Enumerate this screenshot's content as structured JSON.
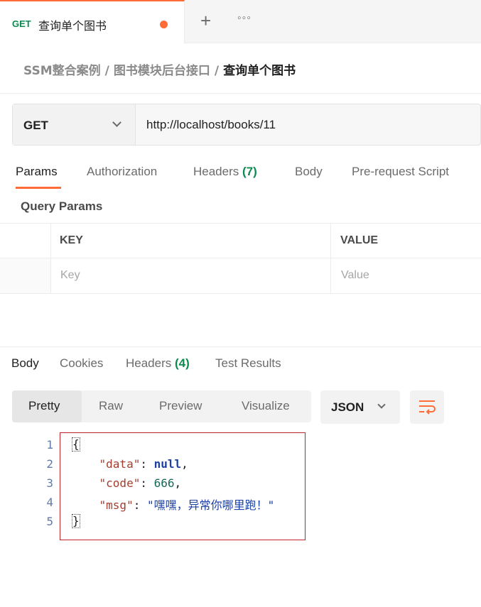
{
  "tab": {
    "method": "GET",
    "name": "查询单个图书",
    "add_icon": "plus-icon",
    "more_icon": "more-icon"
  },
  "breadcrumb": [
    "SSM整合案例",
    "图书模块后台接口",
    "查询单个图书"
  ],
  "breadcrumb_sep": "/",
  "request": {
    "method": "GET",
    "url": "http://localhost/books/11"
  },
  "request_tabs": [
    {
      "label": "Params",
      "active": true
    },
    {
      "label": "Authorization"
    },
    {
      "label": "Headers",
      "count": "(7)"
    },
    {
      "label": "Body"
    },
    {
      "label": "Pre-request Script"
    }
  ],
  "query_params": {
    "title": "Query Params",
    "columns": [
      "KEY",
      "VALUE"
    ],
    "placeholders": [
      "Key",
      "Value"
    ]
  },
  "response_tabs": [
    {
      "label": "Body",
      "active": true
    },
    {
      "label": "Cookies"
    },
    {
      "label": "Headers",
      "count": "(4)"
    },
    {
      "label": "Test Results"
    }
  ],
  "view_modes": [
    "Pretty",
    "Raw",
    "Preview",
    "Visualize"
  ],
  "format": "JSON",
  "code": {
    "line_numbers": [
      "1",
      "2",
      "3",
      "4",
      "5"
    ],
    "open": "{",
    "data_key": "\"data\"",
    "data_val": "null",
    "code_key": "\"code\"",
    "code_val": "666",
    "msg_key": "\"msg\"",
    "msg_val": "\"嘿嘿，异常你哪里跑！\"",
    "close": "}"
  },
  "colors": {
    "accent": "#ff6c37",
    "method_green": "#0d8a4f",
    "highlight": "#c0232c"
  }
}
